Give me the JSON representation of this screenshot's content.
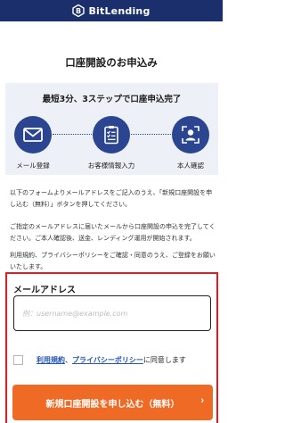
{
  "header": {
    "brand": "BitLending",
    "logo_icon": "bitlending-logo-icon"
  },
  "title": "口座開設のお申込み",
  "steps": {
    "heading": "最短3分、3ステップで口座申込完了",
    "items": [
      {
        "label": "メール登録",
        "icon": "mail-icon"
      },
      {
        "label": "お客様情報入力",
        "icon": "clipboard-checklist-icon"
      },
      {
        "label": "本人確認",
        "icon": "id-scan-icon"
      }
    ]
  },
  "paragraphs": [
    "以下のフォームよりメールアドレスをご記入のうえ、「新規口座開設を申し込む（無料）」ボタンを押してください。",
    "ご指定のメールアドレスに届いたメールから口座開設の申込を完了してください。ご本人確認後、送金、レンディング運用が開始されます。",
    "利用規約、プライバシーポリシーをご確認・同意のうえ、ご登録をお願いいたします。"
  ],
  "form": {
    "email_label": "メールアドレス",
    "email_placeholder": "例：username@example.com",
    "email_value": "",
    "agree": {
      "terms_link": "利用規約",
      "separator": "、",
      "privacy_link": "プライバシーポリシー",
      "suffix": "に同意します"
    },
    "submit_label": "新規口座開設を申し込む（無料）",
    "submit_chevron": "›"
  },
  "colors": {
    "header": "#1a2f6b",
    "step": "#2b4590",
    "accent": "#ef6a25",
    "highlight_border": "#e8191f",
    "link": "#1f53b4"
  }
}
